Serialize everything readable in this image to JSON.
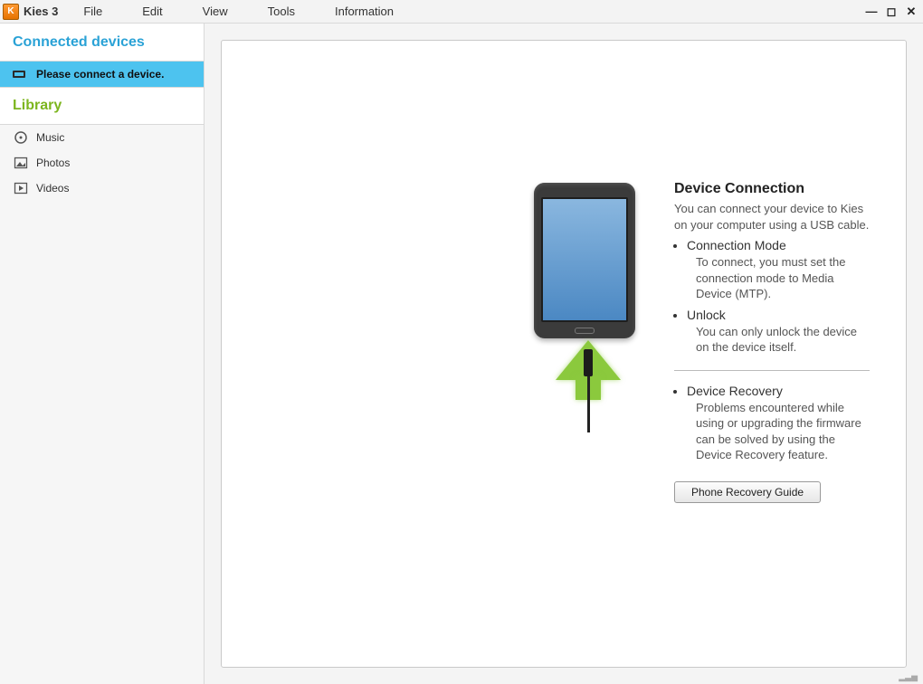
{
  "app": {
    "logo_text": "K",
    "title": "Kies 3"
  },
  "menu": {
    "file": "File",
    "edit": "Edit",
    "view": "View",
    "tools": "Tools",
    "info": "Information"
  },
  "window_controls": {
    "minimize": "—",
    "maximize": "◻",
    "close": "✕"
  },
  "sidebar": {
    "devices_header": "Connected devices",
    "connect_prompt": "Please connect a device.",
    "library_header": "Library",
    "items": [
      {
        "name": "music",
        "label": "Music"
      },
      {
        "name": "photos",
        "label": "Photos"
      },
      {
        "name": "videos",
        "label": "Videos"
      }
    ]
  },
  "content": {
    "heading": "Device Connection",
    "intro": "You can connect your device to Kies on your computer using a USB cable.",
    "points": [
      {
        "title": "Connection Mode",
        "desc": "To connect, you must set the connection mode to Media Device (MTP)."
      },
      {
        "title": "Unlock",
        "desc": "You can only unlock the device on the device itself."
      }
    ],
    "recovery": {
      "title": "Device Recovery",
      "desc": "Problems encountered while using or upgrading the firmware can be solved by using the Device Recovery feature.",
      "button": "Phone Recovery Guide"
    }
  }
}
